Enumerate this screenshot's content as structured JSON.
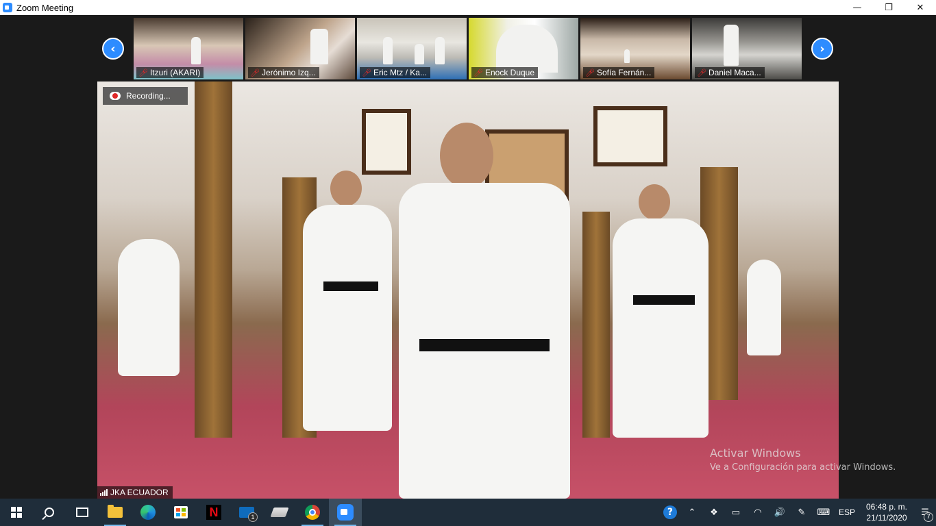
{
  "window": {
    "title": "Zoom Meeting",
    "minimize_glyph": "—",
    "restore_glyph": "❐",
    "close_glyph": "✕"
  },
  "gallery": {
    "prev_glyph": "‹",
    "next_glyph": "›",
    "participants": [
      {
        "name": "Itzuri (AKARI)",
        "muted": true
      },
      {
        "name": "Jerónimo Izq...",
        "muted": true
      },
      {
        "name": "Eric Mtz / Ka...",
        "muted": true
      },
      {
        "name": "Enock Duque",
        "muted": true
      },
      {
        "name": "Sofía Fernán...",
        "muted": true
      },
      {
        "name": "Daniel Maca...",
        "muted": true
      }
    ]
  },
  "main_video": {
    "recording_label": "Recording...",
    "speaker_name": "JKA ECUADOR"
  },
  "watermark": {
    "title": "Activar Windows",
    "subtitle": "Ve a Configuración para activar Windows."
  },
  "taskbar": {
    "apps": [
      {
        "name": "start",
        "icon": "windows-logo"
      },
      {
        "name": "search",
        "icon": "search-icon"
      },
      {
        "name": "task-view",
        "icon": "task-view-icon"
      },
      {
        "name": "file-explorer",
        "icon": "folder-icon"
      },
      {
        "name": "edge",
        "icon": "edge-icon"
      },
      {
        "name": "store",
        "icon": "store-icon"
      },
      {
        "name": "netflix",
        "icon": "netflix-icon"
      },
      {
        "name": "mail",
        "icon": "mail-icon",
        "badge": "1"
      },
      {
        "name": "stack",
        "icon": "stack-icon"
      },
      {
        "name": "chrome",
        "icon": "chrome-icon"
      },
      {
        "name": "zoom",
        "icon": "zoom-icon",
        "active": true
      }
    ],
    "netflix_letter": "N",
    "mail_badge": "1",
    "tray": {
      "help_glyph": "?",
      "chevron_glyph": "⌃",
      "dropbox_glyph": "❖",
      "battery_glyph": "▭",
      "wifi_glyph": "◠",
      "volume_glyph": "🔊",
      "pen_glyph": "✎",
      "keyboard_glyph": "⌨",
      "language": "ESP",
      "time": "06:48 p. m.",
      "date": "21/11/2020",
      "notification_count": "7",
      "notification_glyph": "☰"
    }
  },
  "colors": {
    "zoom_blue": "#2d8cff",
    "taskbar_bg": "#1f2d3a",
    "mute_red": "#e02828"
  }
}
